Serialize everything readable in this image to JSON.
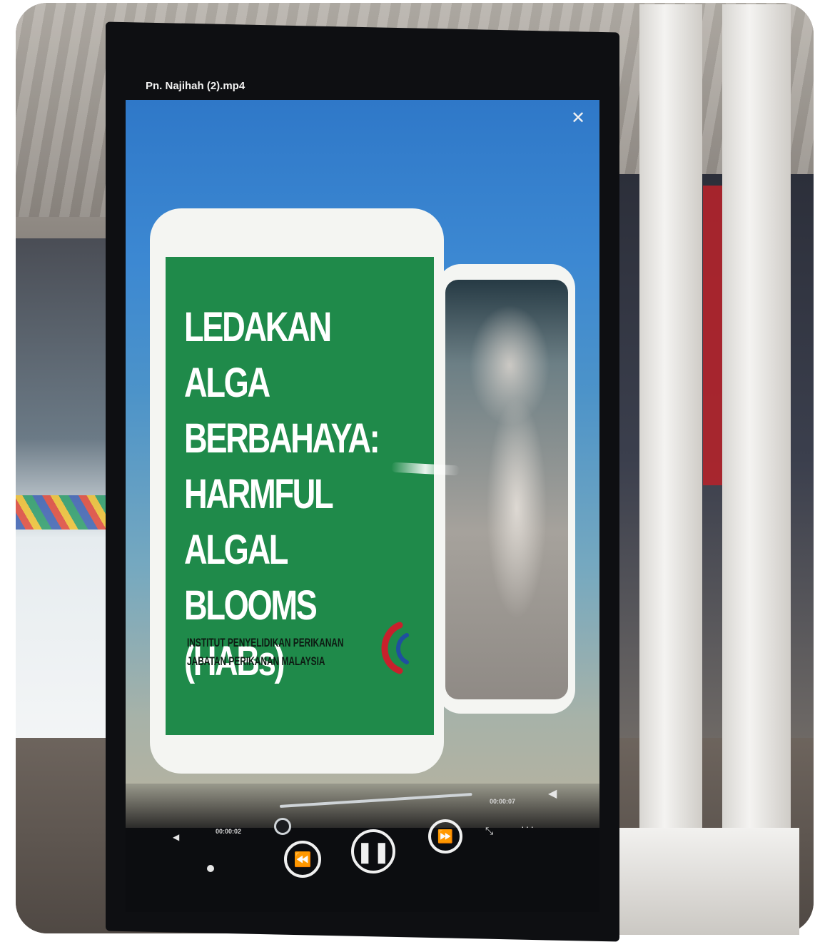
{
  "player": {
    "file_title": "Pn. Najihah (2).mp4",
    "close_icon": "close-icon",
    "time_elapsed": "00:00:02",
    "time_total": "00:00:07",
    "progress_fraction": 0.03
  },
  "slide": {
    "title_lines": [
      "LEDAKAN ALGA",
      "BERBAHAYA:",
      "HARMFUL ALGAL",
      "BLOOMS (HABs)"
    ],
    "institute_line1": "INSTITUT PENYELIDIKAN PERIKANAN",
    "institute_line2": "JABATAN PERIKANAN MALAYSIA"
  },
  "icons": {
    "volume": "volume-icon",
    "rewind": "rewind-icon",
    "pause": "pause-icon",
    "fast_forward": "fast-forward-icon",
    "expand": "expand-icon",
    "more": "more-icon"
  },
  "colors": {
    "slide_green": "#1f8a4a",
    "screen_sky": "#3c88d2",
    "logo_red": "#c8202c",
    "logo_blue": "#1f4fa0"
  }
}
